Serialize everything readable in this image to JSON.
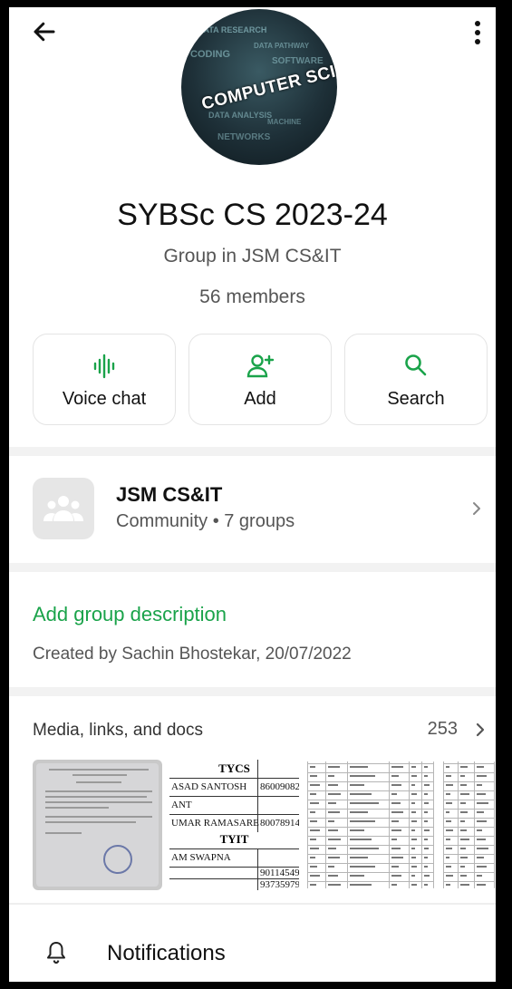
{
  "header": {
    "back_icon": "arrow-left-icon",
    "more_icon": "more-vertical-icon",
    "avatar_text": "COMPUTER SCIENCE"
  },
  "group": {
    "name": "SYBSc CS 2023-24",
    "subtitle": "Group in JSM CS&IT",
    "members": "56 members"
  },
  "actions": [
    {
      "label": "Voice chat",
      "icon": "voice-wave-icon"
    },
    {
      "label": "Add",
      "icon": "add-person-icon"
    },
    {
      "label": "Search",
      "icon": "search-icon"
    }
  ],
  "community": {
    "name": "JSM CS&IT",
    "subtitle": "Community • 7 groups",
    "icon": "community-group-icon"
  },
  "description": {
    "add_label": "Add group description",
    "created": "Created by Sachin Bhostekar, 20/07/2022"
  },
  "media": {
    "heading": "Media, links, and docs",
    "count": "253",
    "thumb2": {
      "header1": "TYCS",
      "header2": "TYIT",
      "rows": [
        "ASAD SANTOSH",
        "ANT",
        "UMAR RAMASARE",
        "AM SWAPNA"
      ],
      "nums": [
        "86009082",
        "80078914",
        "90114549",
        "93735979"
      ]
    }
  },
  "notifications": {
    "label": "Notifications",
    "icon": "bell-icon"
  },
  "colors": {
    "accent": "#1aa34a",
    "text_primary": "#111111",
    "text_secondary": "#555555"
  }
}
